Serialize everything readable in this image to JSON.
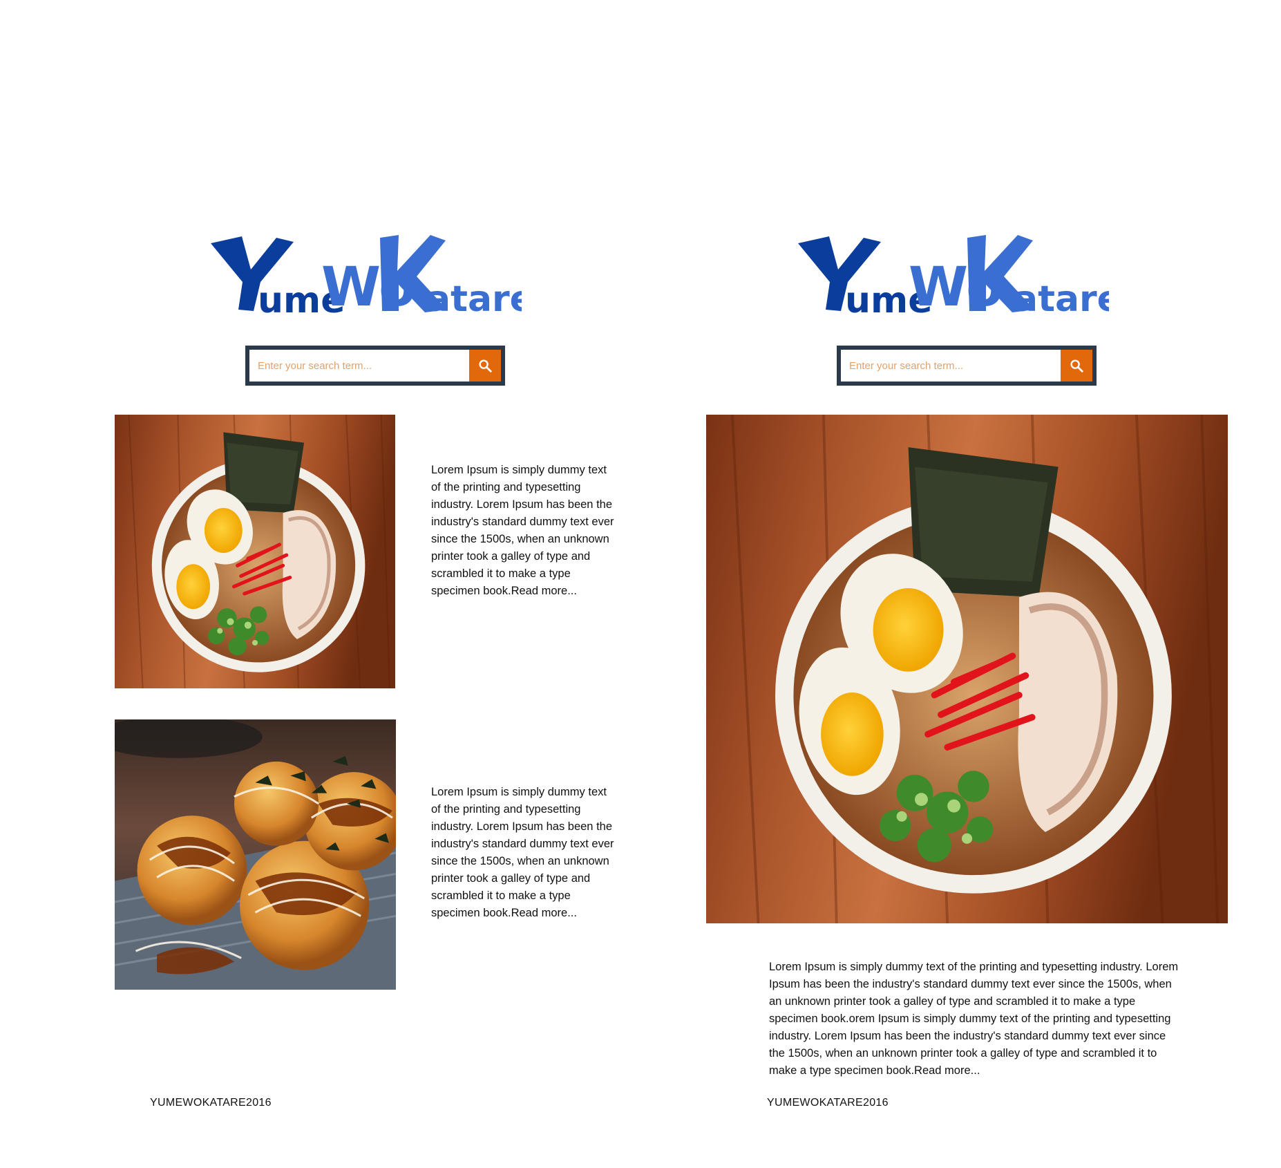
{
  "brand": {
    "logo_text": "YumeWoKatare",
    "logo_colors": {
      "primary": "#0b3d9c",
      "secondary": "#3a6fd1"
    }
  },
  "search": {
    "placeholder": "Enter your search term...",
    "button_icon": "search-icon",
    "border_color": "#2b3a4a",
    "button_color": "#e2690b"
  },
  "left_panel": {
    "items": [
      {
        "image": "ramen-bowl-photo",
        "text": "Lorem Ipsum is simply dummy text of the printing and typesetting industry. Lorem Ipsum has been the industry's standard dummy text ever since the 1500s, when an unknown printer took a galley of type and scrambled it to make a type specimen book.",
        "read_more": "Read more..."
      },
      {
        "image": "takoyaki-photo",
        "text": "Lorem Ipsum is simply dummy text of the printing and typesetting industry. Lorem Ipsum has been the industry's standard dummy text ever since the 1500s, when an unknown printer took a galley of type and scrambled it to make a type specimen book.",
        "read_more": "Read more..."
      }
    ],
    "footer": "YUMEWOKATARE2016"
  },
  "right_panel": {
    "image": "ramen-bowl-photo-large",
    "text": "Lorem Ipsum is simply dummy text of the printing and typesetting industry. Lorem Ipsum has been the industry's standard dummy text ever since the 1500s, when an unknown printer took a galley of type and scrambled it to make a type specimen book.orem Ipsum is simply dummy text of the printing and typesetting industry. Lorem Ipsum has been the industry's standard dummy text ever since the 1500s, when an unknown printer took a galley of type and scrambled it to make a type specimen book.",
    "read_more": "Read more...",
    "footer": "YUMEWOKATARE2016"
  }
}
